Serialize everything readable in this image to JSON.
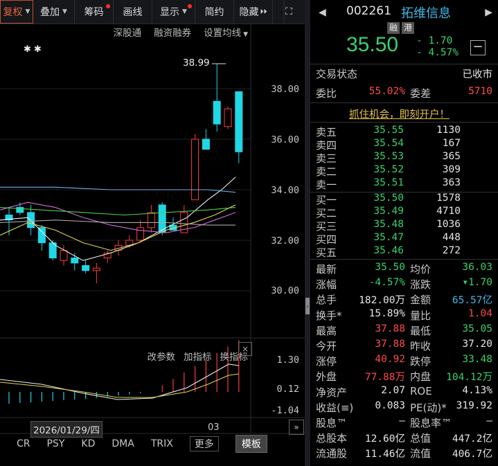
{
  "toolbar": {
    "items": [
      {
        "label": "复权",
        "active": true,
        "caret": true,
        "dot": false
      },
      {
        "label": "叠加",
        "caret": true,
        "dot": false
      },
      {
        "label": "筹码",
        "caret": false,
        "dot": true
      },
      {
        "label": "画线",
        "caret": false,
        "dot": false
      },
      {
        "label": "显示",
        "caret": true,
        "dot": true
      },
      {
        "label": "简约",
        "caret": false,
        "dot": false
      },
      {
        "label": "隐藏",
        "caret": false,
        "dot": false
      }
    ],
    "expand_glyph": "⏵⏵",
    "fullscreen_glyph": "⛶"
  },
  "subbar": [
    "深股通",
    "融资融券",
    "设置均线"
  ],
  "stars": "✱✱",
  "price_axis": [
    "38.00",
    "36.00",
    "34.00",
    "32.00",
    "30.00"
  ],
  "max_marker": "38.99",
  "indicator_bar": [
    "改参数",
    "加指标",
    "换指标"
  ],
  "indicator_close": "×",
  "indicator_axis": [
    "1.30",
    "0.12",
    "-1.04"
  ],
  "cursor_date": "2026/01/29/四",
  "x_label": "03",
  "bottom_tabs": [
    "CR",
    "PSY",
    "KD",
    "DMA",
    "TRIX"
  ],
  "bottom_more": "更多",
  "bottom_board": "模板",
  "quote": {
    "code": "002261",
    "name": "拓维信息",
    "tags": [
      "融",
      "港"
    ],
    "price": "35.50",
    "change": "- 1.70",
    "change_pct": "- 4.57%",
    "trade_status_label": "交易状态",
    "trade_status": "已收市",
    "weibi_label": "委比",
    "weibi": "55.02%",
    "weicha_label": "委差",
    "weicha": "5710",
    "promo": "抓住机会，即刻开户！"
  },
  "sell": [
    {
      "label": "卖五",
      "price": "35.55",
      "vol": "1130"
    },
    {
      "label": "卖四",
      "price": "35.54",
      "vol": "167"
    },
    {
      "label": "卖三",
      "price": "35.53",
      "vol": "365"
    },
    {
      "label": "卖二",
      "price": "35.52",
      "vol": "309"
    },
    {
      "label": "卖一",
      "price": "35.51",
      "vol": "363"
    }
  ],
  "buy": [
    {
      "label": "买一",
      "price": "35.50",
      "vol": "1578"
    },
    {
      "label": "买二",
      "price": "35.49",
      "vol": "4710"
    },
    {
      "label": "买三",
      "price": "35.48",
      "vol": "1036"
    },
    {
      "label": "买四",
      "price": "35.47",
      "vol": "448"
    },
    {
      "label": "买五",
      "price": "35.46",
      "vol": "272"
    }
  ],
  "stats": [
    {
      "l1": "最新",
      "v1": "35.50",
      "c1": "green",
      "l2": "均价",
      "v2": "36.03",
      "c2": "green"
    },
    {
      "l1": "涨幅",
      "v1": "-4.57%",
      "c1": "green",
      "l2": "涨跌",
      "v2": "▾1.70",
      "c2": "green"
    },
    {
      "l1": "总手",
      "v1": "182.00万",
      "c1": "white",
      "l2": "金额",
      "v2": "65.57亿",
      "c2": "cyan"
    },
    {
      "l1": "换手*",
      "v1": "15.89%",
      "c1": "white",
      "l2": "量比",
      "v2": "1.04",
      "c2": "red"
    },
    {
      "l1": "最高",
      "v1": "37.88",
      "c1": "red",
      "l2": "最低",
      "v2": "35.05",
      "c2": "green"
    },
    {
      "l1": "今开",
      "v1": "37.88",
      "c1": "red",
      "l2": "昨收",
      "v2": "37.20",
      "c2": "white"
    },
    {
      "l1": "涨停",
      "v1": "40.92",
      "c1": "red",
      "l2": "跌停",
      "v2": "33.48",
      "c2": "green"
    },
    {
      "l1": "外盘",
      "v1": "77.88万",
      "c1": "red",
      "l2": "内盘",
      "v2": "104.12万",
      "c2": "green"
    },
    {
      "l1": "净资产",
      "v1": "2.07",
      "c1": "white",
      "l2": "ROE",
      "v2": "4.13%",
      "c2": "white"
    },
    {
      "l1": "收益(≡)",
      "v1": "0.083",
      "c1": "white",
      "l2": "PE(动)*",
      "v2": "319.92",
      "c2": "white"
    },
    {
      "l1": "股息™",
      "v1": "—",
      "c1": "white",
      "l2": "股息率™",
      "v2": "—",
      "c2": "white"
    },
    {
      "l1": "总股本",
      "v1": "12.60亿",
      "c1": "white",
      "l2": "总值",
      "v2": "447.2亿",
      "c2": "white"
    },
    {
      "l1": "流通股",
      "v1": "11.46亿",
      "c1": "white",
      "l2": "流值",
      "v2": "406.7亿",
      "c2": "white"
    }
  ],
  "colors": {
    "up": "#ff3b3b",
    "down": "#1fd7e6",
    "green": "#37d26f",
    "accent": "#e8643c"
  }
}
